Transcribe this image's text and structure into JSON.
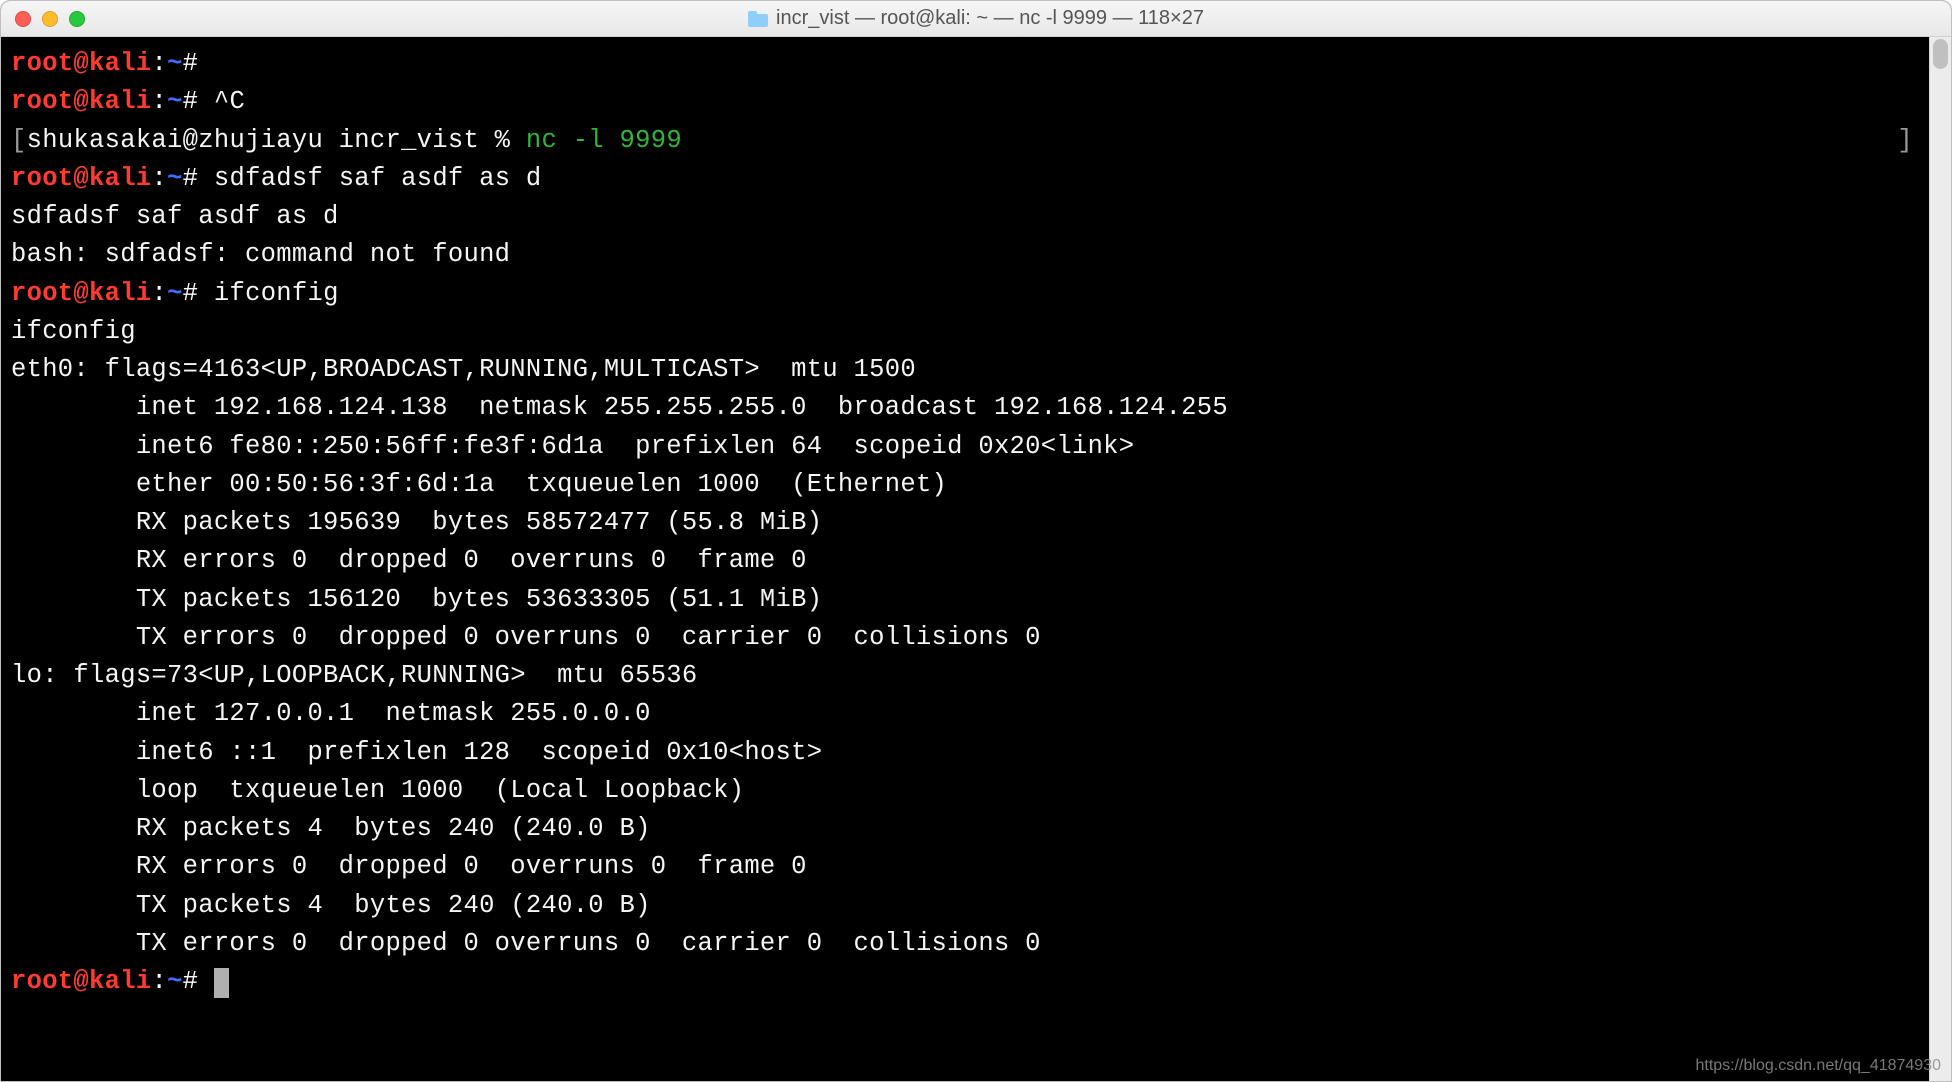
{
  "titlebar": {
    "title": "incr_vist — root@kali: ~ — nc -l 9999 — 118×27"
  },
  "prompt": {
    "user": "root",
    "at": "@",
    "host": "kali",
    "colon": ":",
    "path": "~",
    "hash": "#"
  },
  "lines": {
    "l1_cmd": " ",
    "l2_cmd": " ^C",
    "l3_prefix": "[",
    "l3_shell": "shukasakai@zhujiayu incr_vist % ",
    "l3_nc": "nc -l 9999",
    "l3_suffix": "]",
    "l4_cmd": " sdfadsf saf asdf as d",
    "l5": "sdfadsf saf asdf as d",
    "l6": "bash: sdfadsf: command not found",
    "l7_cmd": " ifconfig",
    "l8": "ifconfig",
    "l9": "eth0: flags=4163<UP,BROADCAST,RUNNING,MULTICAST>  mtu 1500",
    "l10": "        inet 192.168.124.138  netmask 255.255.255.0  broadcast 192.168.124.255",
    "l11": "        inet6 fe80::250:56ff:fe3f:6d1a  prefixlen 64  scopeid 0x20<link>",
    "l12": "        ether 00:50:56:3f:6d:1a  txqueuelen 1000  (Ethernet)",
    "l13": "        RX packets 195639  bytes 58572477 (55.8 MiB)",
    "l14": "        RX errors 0  dropped 0  overruns 0  frame 0",
    "l15": "        TX packets 156120  bytes 53633305 (51.1 MiB)",
    "l16": "        TX errors 0  dropped 0 overruns 0  carrier 0  collisions 0",
    "l17": "",
    "l18": "lo: flags=73<UP,LOOPBACK,RUNNING>  mtu 65536",
    "l19": "        inet 127.0.0.1  netmask 255.0.0.0",
    "l20": "        inet6 ::1  prefixlen 128  scopeid 0x10<host>",
    "l21": "        loop  txqueuelen 1000  (Local Loopback)",
    "l22": "        RX packets 4  bytes 240 (240.0 B)",
    "l23": "        RX errors 0  dropped 0  overruns 0  frame 0",
    "l24": "        TX packets 4  bytes 240 (240.0 B)",
    "l25": "        TX errors 0  dropped 0 overruns 0  carrier 0  collisions 0",
    "l26": "",
    "l27_cmd": " "
  },
  "watermark": "https://blog.csdn.net/qq_41874930"
}
